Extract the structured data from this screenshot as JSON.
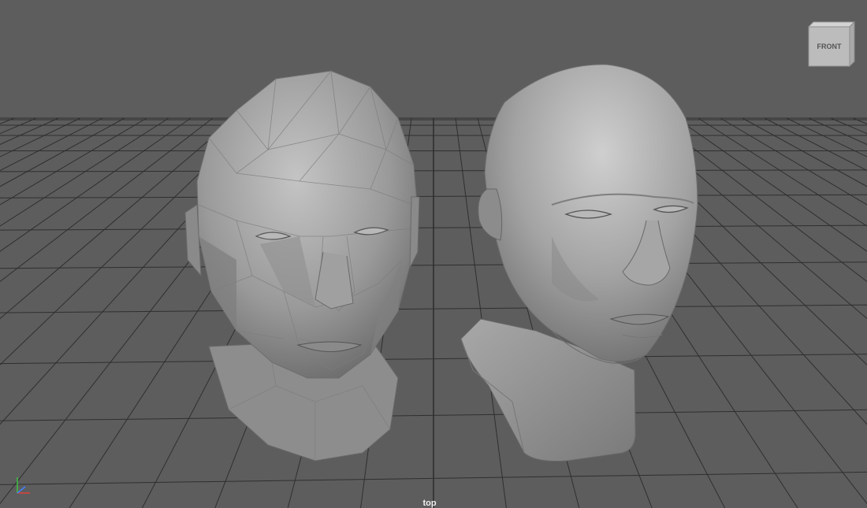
{
  "viewport": {
    "camera_name": "top",
    "view_cube_face": "FRONT",
    "background_color": "#5d5d5d",
    "grid_color": "#2f2f2f",
    "mesh_color": "#9a9a9a"
  },
  "scene": {
    "objects": [
      {
        "name": "low-poly-head",
        "shading": "faceted"
      },
      {
        "name": "smooth-head-bust",
        "shading": "smooth"
      }
    ]
  },
  "axis_gizmo": {
    "axes": [
      "X",
      "Y",
      "Z"
    ],
    "colors": {
      "x": "#e04040",
      "y": "#40c040",
      "z": "#4080ff"
    }
  }
}
